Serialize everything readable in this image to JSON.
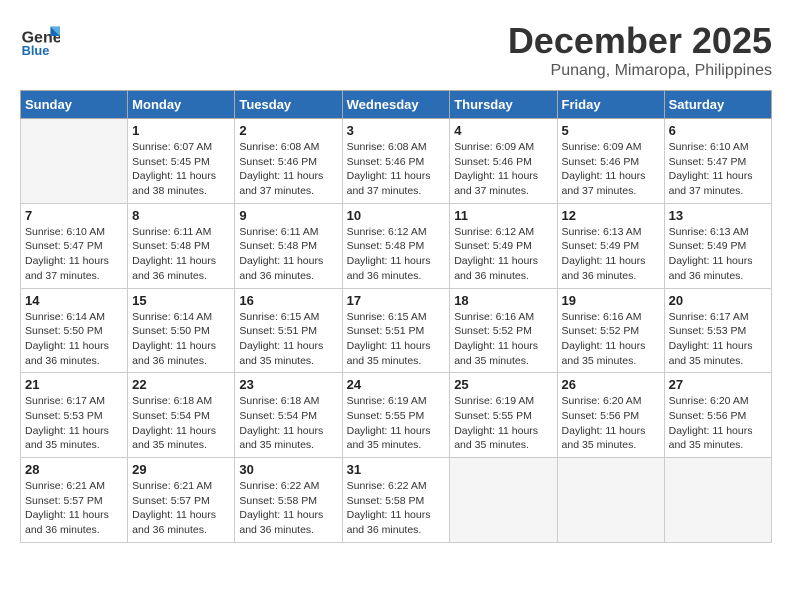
{
  "header": {
    "logo_line1": "General",
    "logo_line2": "Blue",
    "month_title": "December 2025",
    "location": "Punang, Mimaropa, Philippines"
  },
  "weekdays": [
    "Sunday",
    "Monday",
    "Tuesday",
    "Wednesday",
    "Thursday",
    "Friday",
    "Saturday"
  ],
  "weeks": [
    [
      {
        "day": "",
        "sunrise": "",
        "sunset": "",
        "daylight": ""
      },
      {
        "day": "1",
        "sunrise": "6:07 AM",
        "sunset": "5:45 PM",
        "daylight": "11 hours and 38 minutes."
      },
      {
        "day": "2",
        "sunrise": "6:08 AM",
        "sunset": "5:46 PM",
        "daylight": "11 hours and 37 minutes."
      },
      {
        "day": "3",
        "sunrise": "6:08 AM",
        "sunset": "5:46 PM",
        "daylight": "11 hours and 37 minutes."
      },
      {
        "day": "4",
        "sunrise": "6:09 AM",
        "sunset": "5:46 PM",
        "daylight": "11 hours and 37 minutes."
      },
      {
        "day": "5",
        "sunrise": "6:09 AM",
        "sunset": "5:46 PM",
        "daylight": "11 hours and 37 minutes."
      },
      {
        "day": "6",
        "sunrise": "6:10 AM",
        "sunset": "5:47 PM",
        "daylight": "11 hours and 37 minutes."
      }
    ],
    [
      {
        "day": "7",
        "sunrise": "6:10 AM",
        "sunset": "5:47 PM",
        "daylight": "11 hours and 37 minutes."
      },
      {
        "day": "8",
        "sunrise": "6:11 AM",
        "sunset": "5:48 PM",
        "daylight": "11 hours and 36 minutes."
      },
      {
        "day": "9",
        "sunrise": "6:11 AM",
        "sunset": "5:48 PM",
        "daylight": "11 hours and 36 minutes."
      },
      {
        "day": "10",
        "sunrise": "6:12 AM",
        "sunset": "5:48 PM",
        "daylight": "11 hours and 36 minutes."
      },
      {
        "day": "11",
        "sunrise": "6:12 AM",
        "sunset": "5:49 PM",
        "daylight": "11 hours and 36 minutes."
      },
      {
        "day": "12",
        "sunrise": "6:13 AM",
        "sunset": "5:49 PM",
        "daylight": "11 hours and 36 minutes."
      },
      {
        "day": "13",
        "sunrise": "6:13 AM",
        "sunset": "5:49 PM",
        "daylight": "11 hours and 36 minutes."
      }
    ],
    [
      {
        "day": "14",
        "sunrise": "6:14 AM",
        "sunset": "5:50 PM",
        "daylight": "11 hours and 36 minutes."
      },
      {
        "day": "15",
        "sunrise": "6:14 AM",
        "sunset": "5:50 PM",
        "daylight": "11 hours and 36 minutes."
      },
      {
        "day": "16",
        "sunrise": "6:15 AM",
        "sunset": "5:51 PM",
        "daylight": "11 hours and 35 minutes."
      },
      {
        "day": "17",
        "sunrise": "6:15 AM",
        "sunset": "5:51 PM",
        "daylight": "11 hours and 35 minutes."
      },
      {
        "day": "18",
        "sunrise": "6:16 AM",
        "sunset": "5:52 PM",
        "daylight": "11 hours and 35 minutes."
      },
      {
        "day": "19",
        "sunrise": "6:16 AM",
        "sunset": "5:52 PM",
        "daylight": "11 hours and 35 minutes."
      },
      {
        "day": "20",
        "sunrise": "6:17 AM",
        "sunset": "5:53 PM",
        "daylight": "11 hours and 35 minutes."
      }
    ],
    [
      {
        "day": "21",
        "sunrise": "6:17 AM",
        "sunset": "5:53 PM",
        "daylight": "11 hours and 35 minutes."
      },
      {
        "day": "22",
        "sunrise": "6:18 AM",
        "sunset": "5:54 PM",
        "daylight": "11 hours and 35 minutes."
      },
      {
        "day": "23",
        "sunrise": "6:18 AM",
        "sunset": "5:54 PM",
        "daylight": "11 hours and 35 minutes."
      },
      {
        "day": "24",
        "sunrise": "6:19 AM",
        "sunset": "5:55 PM",
        "daylight": "11 hours and 35 minutes."
      },
      {
        "day": "25",
        "sunrise": "6:19 AM",
        "sunset": "5:55 PM",
        "daylight": "11 hours and 35 minutes."
      },
      {
        "day": "26",
        "sunrise": "6:20 AM",
        "sunset": "5:56 PM",
        "daylight": "11 hours and 35 minutes."
      },
      {
        "day": "27",
        "sunrise": "6:20 AM",
        "sunset": "5:56 PM",
        "daylight": "11 hours and 35 minutes."
      }
    ],
    [
      {
        "day": "28",
        "sunrise": "6:21 AM",
        "sunset": "5:57 PM",
        "daylight": "11 hours and 36 minutes."
      },
      {
        "day": "29",
        "sunrise": "6:21 AM",
        "sunset": "5:57 PM",
        "daylight": "11 hours and 36 minutes."
      },
      {
        "day": "30",
        "sunrise": "6:22 AM",
        "sunset": "5:58 PM",
        "daylight": "11 hours and 36 minutes."
      },
      {
        "day": "31",
        "sunrise": "6:22 AM",
        "sunset": "5:58 PM",
        "daylight": "11 hours and 36 minutes."
      },
      {
        "day": "",
        "sunrise": "",
        "sunset": "",
        "daylight": ""
      },
      {
        "day": "",
        "sunrise": "",
        "sunset": "",
        "daylight": ""
      },
      {
        "day": "",
        "sunrise": "",
        "sunset": "",
        "daylight": ""
      }
    ]
  ],
  "labels": {
    "sunrise_prefix": "Sunrise: ",
    "sunset_prefix": "Sunset: ",
    "daylight_prefix": "Daylight: "
  }
}
